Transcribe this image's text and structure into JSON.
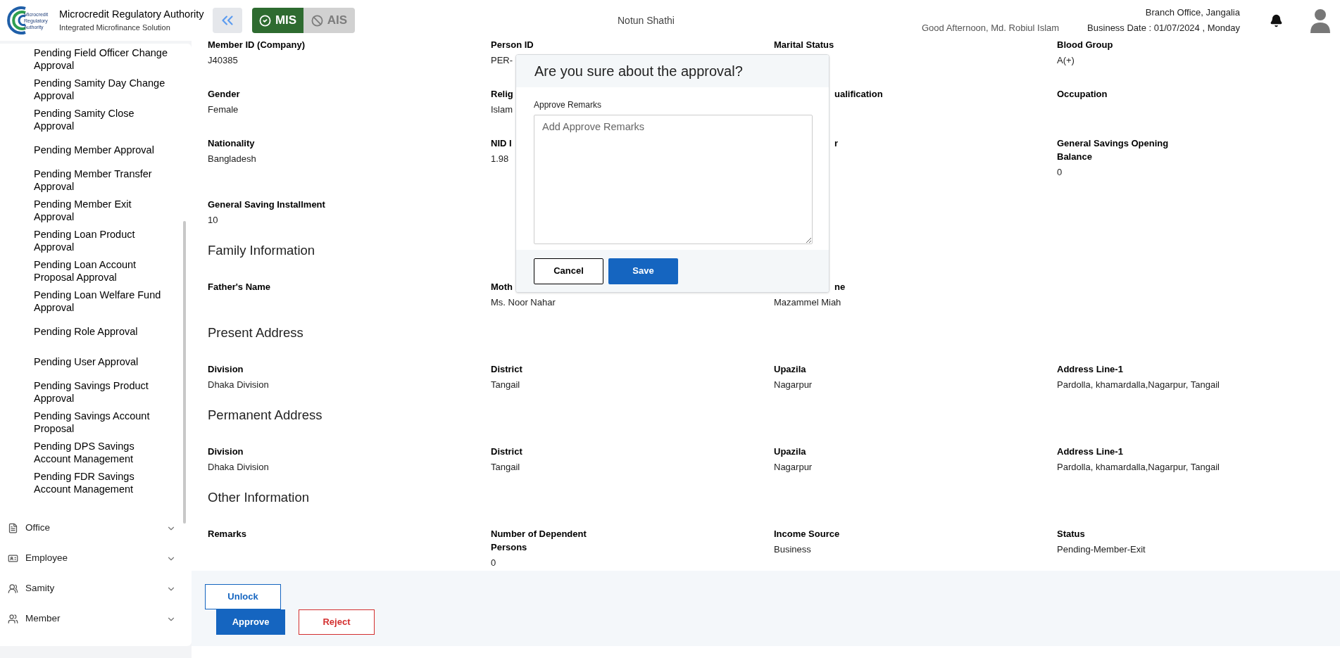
{
  "header": {
    "logo_lines": [
      "Microcredit",
      "Regulatory",
      "Authority"
    ],
    "title": "Microcredit Regulatory Authority",
    "subtitle": "Integrated Microfinance Solution",
    "modules": [
      {
        "label": "MIS",
        "selected": true
      },
      {
        "label": "AIS",
        "selected": false
      }
    ],
    "organization": "Notun Shathi",
    "greeting": "Good Afternoon, Md. Robiul Islam",
    "branch": "Branch Office, Jangalia",
    "business_date": "Business Date : 01/07/2024 , Monday"
  },
  "sidebar": {
    "items": [
      "Pending Field Officer Change Approval",
      "Pending Samity Day Change Approval",
      "Pending Samity Close Approval",
      "Pending Member Approval",
      "Pending Member Transfer Approval",
      "Pending Member Exit Approval",
      "Pending Loan Product Approval",
      "Pending Loan Account Proposal Approval",
      "Pending Loan Welfare Fund Approval",
      "Pending Role Approval",
      "Pending User Approval",
      "Pending Savings Product Approval",
      "Pending Savings Account Proposal",
      "Pending DPS Savings Account Management",
      "Pending FDR Savings Account Management"
    ],
    "menus": [
      {
        "label": "Office",
        "kind": "office",
        "expanded": false
      },
      {
        "label": "Employee",
        "kind": "employee",
        "expanded": false
      },
      {
        "label": "Samity",
        "kind": "samity",
        "expanded": false
      },
      {
        "label": "Member",
        "kind": "member",
        "expanded": false
      }
    ]
  },
  "details": {
    "sections": [
      {
        "rows": [
          {
            "fields": [
              {
                "label": "Member ID (Company)",
                "value": "J40385",
                "kind": "plain"
              },
              {
                "label": "Person ID",
                "value": "PER-",
                "kind": "plain"
              },
              {
                "label": "Marital Status",
                "kind": "plain"
              },
              {
                "label": "Blood Group",
                "value": "A(+)",
                "kind": "plain"
              }
            ]
          },
          {
            "fields": [
              {
                "label": "Gender",
                "value": "Female",
                "kind": "plain"
              },
              {
                "label": "Relig",
                "value": "Islam",
                "kind": "plain"
              },
              {
                "label": "ualification",
                "kind": "cut"
              },
              {
                "label": "Occupation",
                "kind": "plain"
              }
            ]
          },
          {
            "fields": [
              {
                "label": "Nationality",
                "value": "Bangladesh",
                "kind": "plain"
              },
              {
                "label": "NID I",
                "value": "1.98",
                "kind": "plain"
              },
              {
                "label": "r",
                "kind": "cut"
              },
              {
                "label": "General Savings Opening Balance",
                "value": "0",
                "kind": "plain"
              }
            ]
          },
          {
            "fields": [
              {
                "label": "General Saving Installment",
                "value": "10",
                "kind": "plain"
              }
            ]
          }
        ]
      },
      {
        "title": "Family Information",
        "rows": [
          {
            "fields": [
              {
                "label": "Father's Name",
                "kind": "plain"
              },
              {
                "label": "Moth",
                "value": "Ms. Noor Nahar",
                "kind": "plain"
              },
              {
                "label": "ne",
                "value": "Mazammel Miah",
                "kind": "cut"
              }
            ]
          }
        ]
      },
      {
        "title": "Present Address",
        "rows": [
          {
            "fields": [
              {
                "label": "Division",
                "value": "Dhaka Division",
                "kind": "plain"
              },
              {
                "label": "District",
                "value": "Tangail",
                "kind": "plain"
              },
              {
                "label": "Upazila",
                "value": "Nagarpur",
                "kind": "plain"
              },
              {
                "label": "Address Line-1",
                "value": "Pardolla, khamardalla,Nagarpur, Tangail",
                "kind": "plain"
              }
            ]
          }
        ]
      },
      {
        "title": "Permanent Address",
        "rows": [
          {
            "fields": [
              {
                "label": "Division",
                "value": "Dhaka Division",
                "kind": "plain"
              },
              {
                "label": "District",
                "value": "Tangail",
                "kind": "plain"
              },
              {
                "label": "Upazila",
                "value": "Nagarpur",
                "kind": "plain"
              },
              {
                "label": "Address Line-1",
                "value": "Pardolla, khamardalla,Nagarpur, Tangail",
                "kind": "plain"
              }
            ]
          }
        ]
      },
      {
        "title": "Other Information",
        "rows": [
          {
            "fields": [
              {
                "label": "Remarks",
                "kind": "plain"
              },
              {
                "label": "Number of Dependent Persons",
                "value": "0",
                "kind": "plain"
              },
              {
                "label": "Income Source",
                "value": "Business",
                "kind": "plain"
              },
              {
                "label": "Status",
                "value": "Pending-Member-Exit",
                "kind": "plain"
              }
            ]
          }
        ]
      }
    ]
  },
  "actions": [
    {
      "label": "Unlock",
      "kind": "outline"
    },
    {
      "label": "Approve",
      "kind": "primary"
    },
    {
      "label": "Reject",
      "kind": "danger"
    }
  ],
  "dialog": {
    "title": "Are you sure about the approval?",
    "field_label": "Approve Remarks",
    "placeholder": "Add Approve Remarks",
    "buttons": [
      {
        "label": "Cancel",
        "kind": "secondary"
      },
      {
        "label": "Save",
        "kind": "primary"
      }
    ]
  }
}
